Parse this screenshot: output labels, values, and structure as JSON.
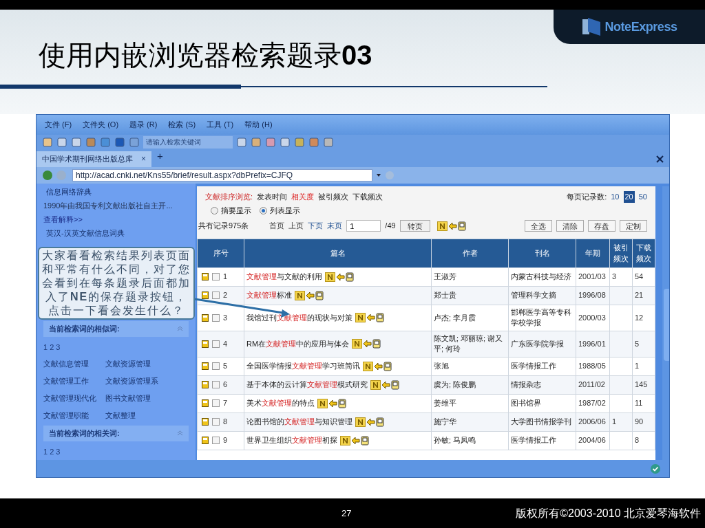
{
  "slide": {
    "title": "使用内嵌浏览器检索题录**03**",
    "logo": "NoteExpress",
    "page_number": "27",
    "copyright": "版权所有©2003-2010 北京爱琴海软件"
  },
  "menu": [
    "文件 (F)",
    "文件夹 (O)",
    "题录 (R)",
    "检索 (S)",
    "工具 (T)",
    "帮助 (H)"
  ],
  "toolbar": {
    "search_placeholder": "请输入检索关键词"
  },
  "tabs": [
    {
      "label": "中国学术期刊网络出版总库",
      "selected": true,
      "close": "×"
    }
  ],
  "new_tab": "+",
  "address": "http://acad.cnki.net/Kns55/brief/result.aspx?dbPrefix=CJFQ",
  "sidebar": {
    "entries": [
      {
        "text": "信息网络辞典",
        "kind": "term"
      },
      {
        "text": "1990年由我国专利文献出版社自主开...",
        "kind": "text"
      },
      {
        "text": "查看解释>>",
        "kind": "link"
      },
      {
        "text": "英汉-汉英文献信息词典",
        "kind": "term"
      }
    ],
    "callout": "大家看看检索结果列表页面和平常有什么不同，对了您会看到在每条题录后面都加入了**NE**的保存题录按钮，点击一下看会发生什么？",
    "sections": [
      {
        "title": "当前检索词的相似词:",
        "expanded": true,
        "pages": "1 2 3",
        "terms": [
          "文献信息管理",
          "文献资源管理",
          "文献管理工作",
          "文献资源管理系",
          "文献管理现代化",
          "图书文献管理",
          "文献管理职能",
          "文献整理"
        ]
      },
      {
        "title": "当前检索词的相关词:",
        "expanded": true,
        "pages": "1 2 3"
      }
    ]
  },
  "main": {
    "sort": {
      "label": "文献排序浏览:",
      "options": [
        {
          "label": "发表时间",
          "selected": false
        },
        {
          "label": "相关度",
          "selected": true
        },
        {
          "label": "被引频次",
          "selected": false
        },
        {
          "label": "下载频次",
          "selected": false
        }
      ]
    },
    "per_page": {
      "label": "每页记录数:",
      "options": [
        {
          "label": "10",
          "selected": false
        },
        {
          "label": "20",
          "selected": true
        },
        {
          "label": "50",
          "selected": false
        }
      ]
    },
    "display": [
      {
        "label": "摘要显示",
        "selected": false
      },
      {
        "label": "列表显示",
        "selected": true
      }
    ],
    "total": "共有记录975条",
    "pager": [
      {
        "label": "首页",
        "enabled": false
      },
      {
        "label": "上页",
        "enabled": false
      },
      {
        "label": "下页",
        "enabled": true
      },
      {
        "label": "末页",
        "enabled": true
      }
    ],
    "page_value": "1",
    "page_total": "/49",
    "go": "转页",
    "actions": [
      "全选",
      "清除",
      "存盘",
      "定制"
    ],
    "columns": [
      "序号",
      "篇名",
      "作者",
      "刊名",
      "年期",
      "被引频次",
      "下载频次"
    ],
    "rows": [
      {
        "number": "1",
        "checked": false,
        "title": [
          {
            "text": "文献管理",
            "hit": true
          },
          {
            "text": "与文献的利用",
            "hit": false
          }
        ],
        "author": "王淑芳",
        "journal": "内蒙古科技与经济",
        "issue": "2001/03",
        "cited": "3",
        "downloads": "54"
      },
      {
        "number": "2",
        "checked": false,
        "title": [
          {
            "text": "文献管理",
            "hit": true
          },
          {
            "text": "标准",
            "hit": false
          }
        ],
        "author": "郑士贵",
        "journal": "管理科学文摘",
        "issue": "1996/08",
        "downloads": "21"
      },
      {
        "number": "3",
        "checked": false,
        "title": [
          {
            "text": "我馆过刊",
            "hit": false
          },
          {
            "text": "文献管理",
            "hit": true
          },
          {
            "text": "的现状与对策",
            "hit": false
          }
        ],
        "author": "卢杰; 李月霞",
        "journal": "邯郸医学高等专科学校学报",
        "issue": "2000/03",
        "downloads": "12"
      },
      {
        "number": "4",
        "checked": false,
        "title": [
          {
            "text": "RM在",
            "hit": false
          },
          {
            "text": "文献管理",
            "hit": true
          },
          {
            "text": "中的应用与体会",
            "hit": false
          }
        ],
        "author": "陈文凯; 邓丽琼; 谢又平; 何玲",
        "journal": "广东医学院学报",
        "issue": "1996/01",
        "downloads": "5"
      },
      {
        "number": "5",
        "checked": false,
        "title": [
          {
            "text": "全国医学情报",
            "hit": false
          },
          {
            "text": "文献管理",
            "hit": true
          },
          {
            "text": "学习班简讯",
            "hit": false
          }
        ],
        "author": "张旭",
        "journal": "医学情报工作",
        "issue": "1988/05",
        "downloads": "1"
      },
      {
        "number": "6",
        "checked": false,
        "title": [
          {
            "text": "基于本体的云计算",
            "hit": false
          },
          {
            "text": "文献管理",
            "hit": true
          },
          {
            "text": "模式研究",
            "hit": false
          }
        ],
        "author": "虞为; 陈俊鹏",
        "journal": "情报杂志",
        "issue": "2011/02",
        "downloads": "145"
      },
      {
        "number": "7",
        "checked": false,
        "title": [
          {
            "text": "美术",
            "hit": false
          },
          {
            "text": "文献管理",
            "hit": true
          },
          {
            "text": "的特点",
            "hit": false
          }
        ],
        "author": "姜维平",
        "journal": "图书馆界",
        "issue": "1987/02",
        "downloads": "11"
      },
      {
        "number": "8",
        "checked": false,
        "title": [
          {
            "text": "论图书馆的",
            "hit": false
          },
          {
            "text": "文献管理",
            "hit": true
          },
          {
            "text": "与知识管理",
            "hit": false
          }
        ],
        "author": "施宁华",
        "journal": "大学图书情报学刊",
        "issue": "2006/06",
        "cited": "1",
        "downloads": "90"
      },
      {
        "number": "9",
        "checked": false,
        "title": [
          {
            "text": "世界卫生组织",
            "hit": false
          },
          {
            "text": "文献管理",
            "hit": true
          },
          {
            "text": "初探",
            "hit": false
          }
        ],
        "author": "孙敏; 马凤鸣",
        "journal": "医学情报工作",
        "issue": "2004/06",
        "downloads": "8"
      }
    ]
  }
}
